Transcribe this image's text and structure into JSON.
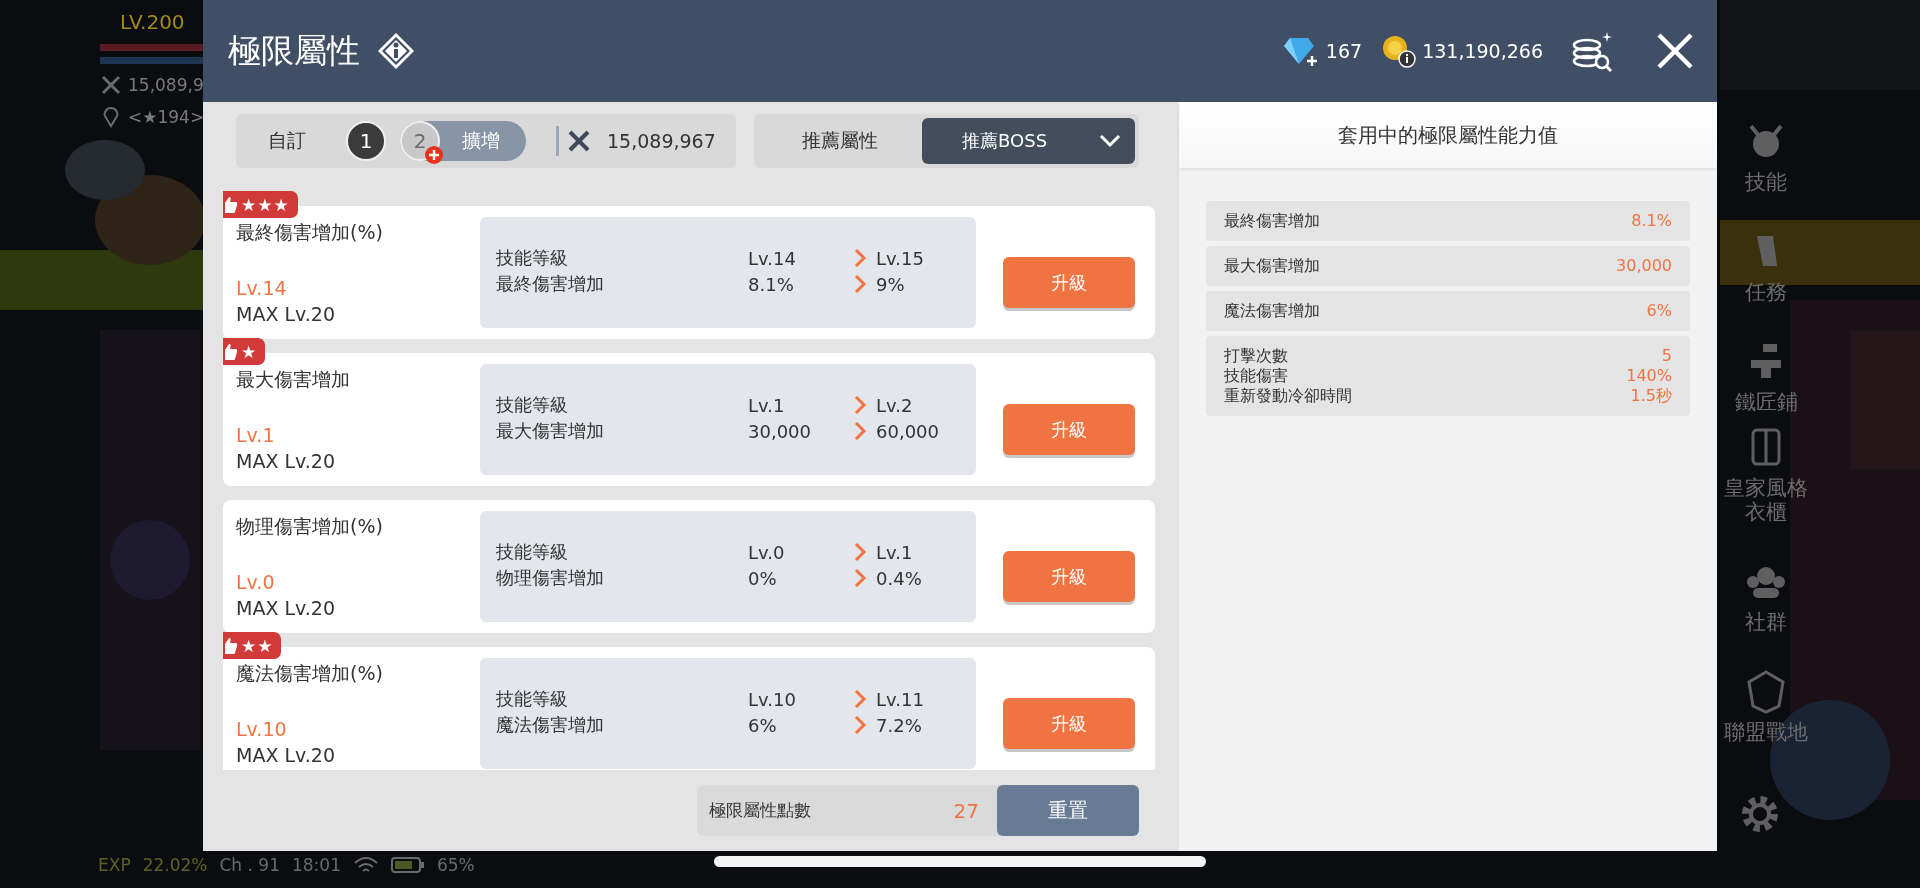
{
  "hud": {
    "level": "LV.200",
    "power": "15,089,9",
    "location": "<★194>"
  },
  "side_menu": [
    {
      "label": "技能",
      "kind": "skill"
    },
    {
      "label": "任務",
      "kind": "quest"
    },
    {
      "label": "鐵匠鋪",
      "kind": "smith"
    },
    {
      "label": "皇家風格衣櫃",
      "kind": "wardrobe"
    },
    {
      "label": "社群",
      "kind": "community"
    },
    {
      "label": "聯盟戰地",
      "kind": "union"
    }
  ],
  "status_bar": {
    "exp_label": "EXP",
    "exp": "22.02%",
    "channel": "Ch . 91",
    "time": "18:01",
    "battery": "65%"
  },
  "dialog": {
    "title": "極限屬性",
    "gems": "167",
    "mesos": "131,190,266",
    "presets": {
      "label": "自訂",
      "slots": [
        {
          "label": "1",
          "selected": true
        },
        {
          "label": "2",
          "selected": false
        }
      ],
      "expand": "擴增"
    },
    "power": "15,089,967",
    "recommend": {
      "label": "推薦屬性",
      "dropdown": "推薦BOSS"
    },
    "stats": [
      {
        "name": "最終傷害增加(%)",
        "badge": "★★★",
        "level": "Lv.14",
        "max": "MAX Lv.20",
        "rows": [
          {
            "label": "技能等級",
            "from": "Lv.14",
            "to": "Lv.15"
          },
          {
            "label": "最終傷害增加",
            "from": "8.1%",
            "to": "9%"
          }
        ],
        "button": "升級"
      },
      {
        "name": "最大傷害增加",
        "badge": "★",
        "level": "Lv.1",
        "max": "MAX Lv.20",
        "rows": [
          {
            "label": "技能等級",
            "from": "Lv.1",
            "to": "Lv.2"
          },
          {
            "label": "最大傷害增加",
            "from": "30,000",
            "to": "60,000"
          }
        ],
        "button": "升級"
      },
      {
        "name": "物理傷害增加(%)",
        "level": "Lv.0",
        "max": "MAX Lv.20",
        "rows": [
          {
            "label": "技能等級",
            "from": "Lv.0",
            "to": "Lv.1"
          },
          {
            "label": "物理傷害增加",
            "from": "0%",
            "to": "0.4%"
          }
        ],
        "button": "升級"
      },
      {
        "name": "魔法傷害增加(%)",
        "badge": "★★",
        "level": "Lv.10",
        "max": "MAX Lv.20",
        "rows": [
          {
            "label": "技能等級",
            "from": "Lv.10",
            "to": "Lv.11"
          },
          {
            "label": "魔法傷害增加",
            "from": "6%",
            "to": "7.2%"
          }
        ],
        "button": "升級"
      }
    ],
    "points": {
      "label": "極限屬性點數",
      "value": "27"
    },
    "reset": "重置",
    "applied": {
      "title": "套用中的極限屬性能力值",
      "rows": [
        {
          "labels": [
            "最終傷害增加"
          ],
          "values": [
            "8.1%"
          ]
        },
        {
          "labels": [
            "最大傷害增加"
          ],
          "values": [
            "30,000"
          ]
        },
        {
          "labels": [
            "魔法傷害增加"
          ],
          "values": [
            "6%"
          ]
        },
        {
          "labels": [
            "打擊次數",
            "技能傷害",
            "重新發動冷卻時間"
          ],
          "values": [
            "5",
            "140%",
            "1.5秒"
          ]
        }
      ]
    }
  }
}
